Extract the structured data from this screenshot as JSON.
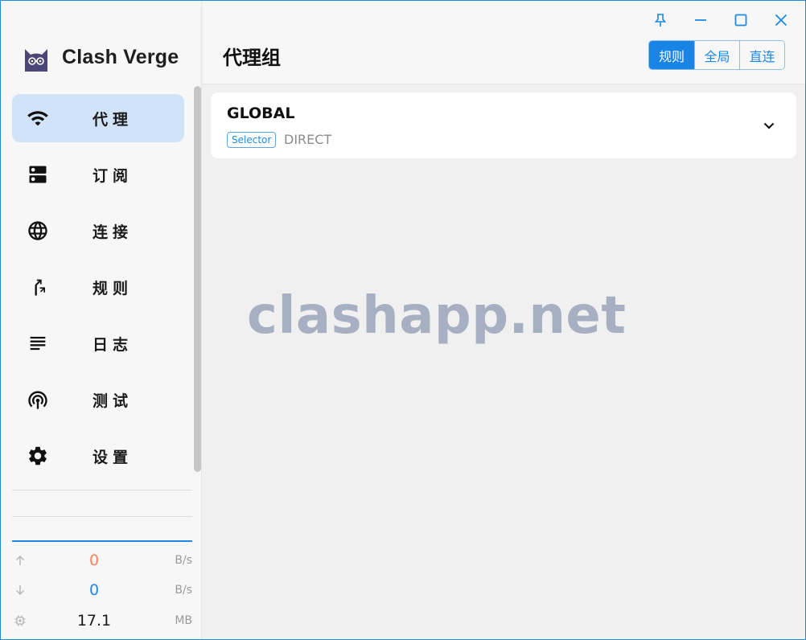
{
  "app": {
    "title": "Clash Verge"
  },
  "sidebar": {
    "items": [
      {
        "label": "代理",
        "icon": "wifi-icon",
        "active": true
      },
      {
        "label": "订阅",
        "icon": "dns-icon",
        "active": false
      },
      {
        "label": "连接",
        "icon": "language-icon",
        "active": false
      },
      {
        "label": "规则",
        "icon": "fork-right-icon",
        "active": false
      },
      {
        "label": "日志",
        "icon": "subject-icon",
        "active": false
      },
      {
        "label": "测试",
        "icon": "wifi-tethering-icon",
        "active": false
      },
      {
        "label": "设置",
        "icon": "settings-icon",
        "active": false
      }
    ]
  },
  "traffic": {
    "upload": {
      "value": "0",
      "unit": "B/s",
      "color": "#f4855d"
    },
    "download": {
      "value": "0",
      "unit": "B/s",
      "color": "#1e88e5"
    },
    "memory": {
      "value": "17.1",
      "unit": "MB",
      "color": "#1a1a1a"
    }
  },
  "header": {
    "title": "代理组",
    "modes": [
      {
        "label": "规则",
        "active": true
      },
      {
        "label": "全局",
        "active": false
      },
      {
        "label": "直连",
        "active": false
      }
    ]
  },
  "proxy_groups": [
    {
      "name": "GLOBAL",
      "type": "Selector",
      "now": "DIRECT"
    }
  ],
  "watermark": "clashapp.net",
  "colors": {
    "accent": "#1e88e5",
    "active_nav": "#d1e3f8"
  }
}
